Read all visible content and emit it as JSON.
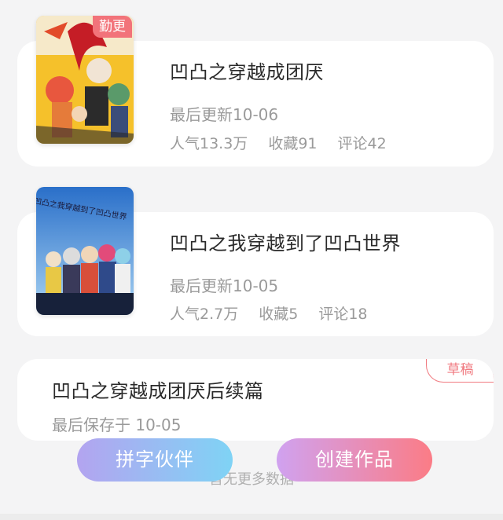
{
  "works": [
    {
      "tag": "勤更",
      "title": "凹凸之穿越成团厌",
      "updated": "最后更新10-06",
      "popularity": "人气13.3万",
      "favorites": "收藏91",
      "comments": "评论42"
    },
    {
      "tag": "",
      "title": "凹凸之我穿越到了凹凸世界",
      "cover_text": "凹凸之我穿越到了凹凸世界",
      "updated": "最后更新10-05",
      "popularity": "人气2.7万",
      "favorites": "收藏5",
      "comments": "评论18"
    }
  ],
  "draft": {
    "badge": "草稿",
    "title": "凹凸之穿越成团厌后续篇",
    "saved": "最后保存于 10-05"
  },
  "footer": {
    "no_more": "暂无更多数据",
    "partner_button": "拼字伙伴",
    "create_button": "创建作品"
  }
}
